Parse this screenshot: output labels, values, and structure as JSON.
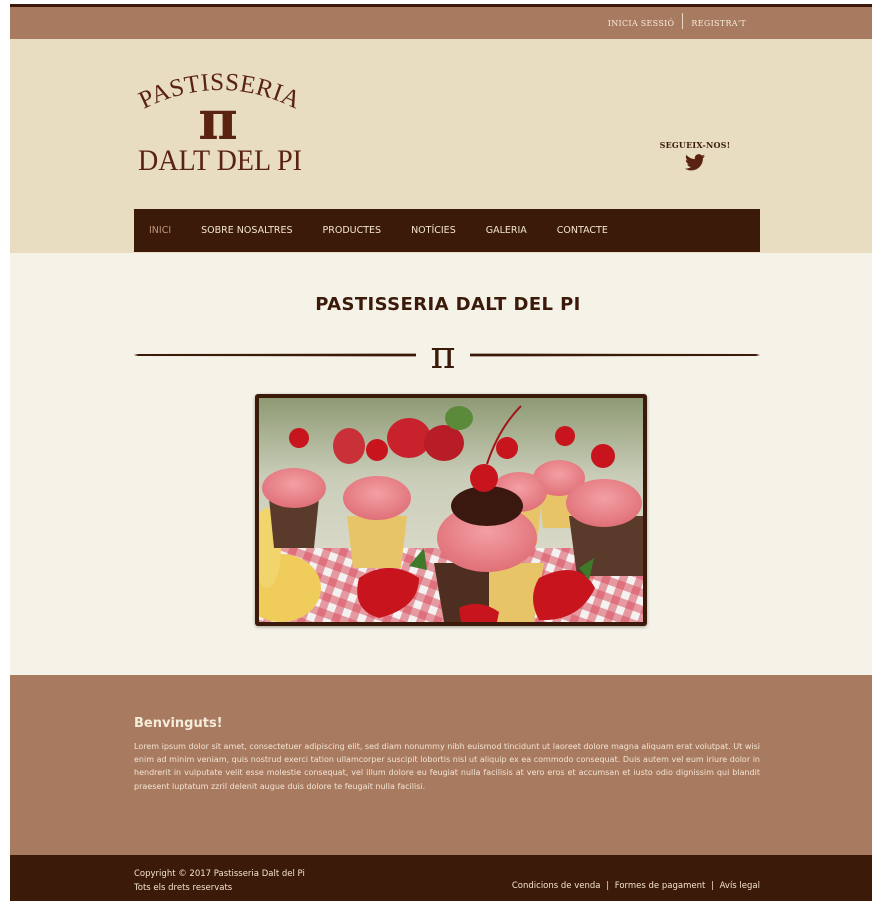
{
  "topbar": {
    "login": "INICIA SESSIÓ",
    "register": "REGISTRA'T"
  },
  "header": {
    "logo_top": "PASTISSERIA",
    "logo_symbol": "π",
    "logo_bottom": "DALT DEL PI",
    "social_label": "SEGUEIX-NOS!",
    "social_icon": "twitter-icon"
  },
  "nav": {
    "items": [
      {
        "label": "INICI"
      },
      {
        "label": "SOBRE NOSALTRES"
      },
      {
        "label": "PRODUCTES"
      },
      {
        "label": "NOTÍCIES"
      },
      {
        "label": "GALERIA"
      },
      {
        "label": "CONTACTE"
      }
    ]
  },
  "main": {
    "title": "PASTISSERIA DALT DEL PI",
    "divider_symbol": "π",
    "image_alt": "cupcakes-photo"
  },
  "welcome": {
    "heading": "Benvinguts!",
    "body": "Lorem ipsum dolor sit amet, consectetuer adipiscing elit, sed diam nonummy nibh euismod tincidunt ut laoreet dolore magna aliquam erat volutpat. Ut wisi enim ad minim veniam, quis nostrud exerci tation ullamcorper suscipit lobortis nisl ut aliquip ex ea commodo consequat. Duis autem vel eum iriure dolor in hendrerit in vulputate velit esse molestie consequat, vel illum dolore eu feugiat nulla facilisis at vero eros et accumsan et iusto odio dignissim qui blandit praesent luptatum zzril delenit augue duis dolore te feugait nulla facilisi."
  },
  "footer": {
    "copyright": "Copyright © 2017 Pastisseria Dalt del Pi",
    "rights": "Tots els drets reservats",
    "links": [
      "Condicions de venda",
      "Formes de pagament",
      "Avís legal"
    ],
    "separator": "|"
  },
  "colors": {
    "brown_dark": "#3b1a0a",
    "brown_mid": "#a87a60",
    "cream": "#e8ddc1",
    "bg_light": "#f5f2e7",
    "nav_active": "#c29478"
  }
}
